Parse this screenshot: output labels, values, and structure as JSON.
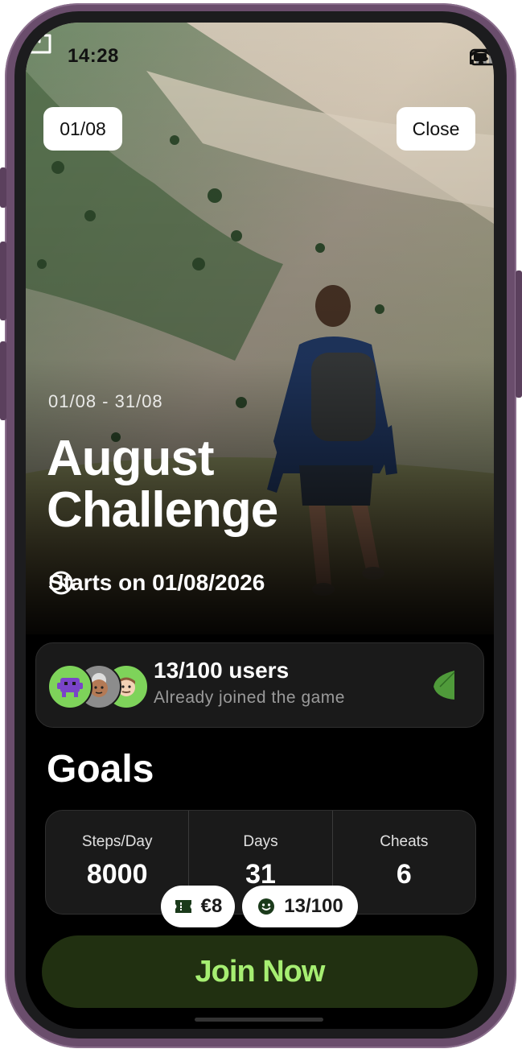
{
  "status_bar": {
    "time": "14:28"
  },
  "header": {
    "counter": "01/08",
    "close_label": "Close"
  },
  "hero": {
    "date_range": "01/08 - 31/08",
    "title_line1": "August",
    "title_line2": "Challenge",
    "starts_text": "Starts on 01/08/2026"
  },
  "users": {
    "count_text": "13/100 users",
    "subtitle": "Already joined the game",
    "avatars": [
      "space-invader-avatar",
      "grandmother-avatar",
      "man-avatar"
    ]
  },
  "goals": {
    "title": "Goals",
    "items": [
      {
        "label": "Steps/Day",
        "value": "8000"
      },
      {
        "label": "Days",
        "value": "31"
      },
      {
        "label": "Cheats",
        "value": "6"
      }
    ]
  },
  "chips": {
    "price": "€8",
    "participants": "13/100"
  },
  "cta": {
    "join_label": "Join Now"
  },
  "colors": {
    "accent_green": "#a6ee72",
    "cta_background": "#213011",
    "frame": "#6a4d6c"
  }
}
